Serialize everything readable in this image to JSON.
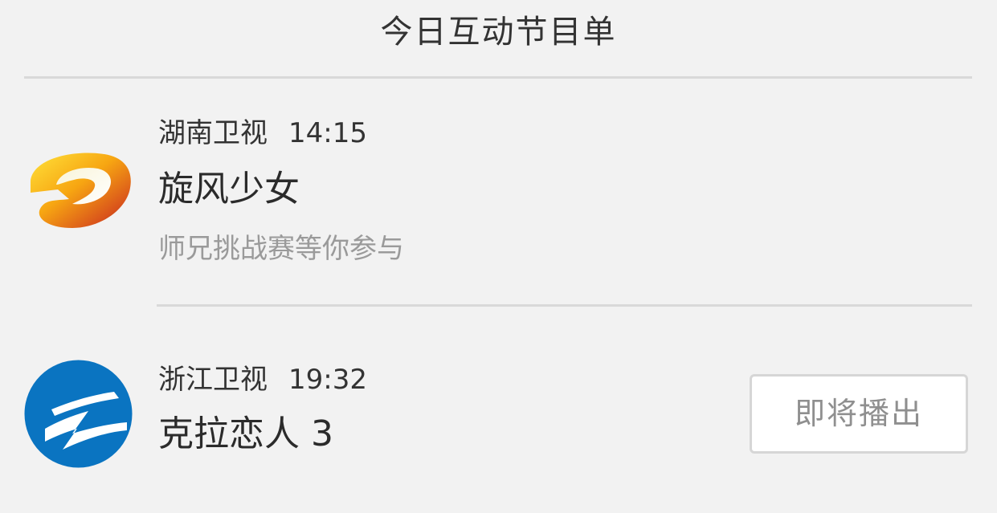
{
  "header": {
    "title": "今日互动节目单"
  },
  "programs": [
    {
      "channel": "湖南卫视",
      "time": "14:15",
      "title": "旋风少女",
      "description": "师兄挑战赛等你参与",
      "logo_icon": "hunan-tv-logo-icon",
      "colors": {
        "logo_primary": "#f5b800",
        "logo_secondary": "#c0390f"
      }
    },
    {
      "channel": "浙江卫视",
      "time": "19:32",
      "title": "克拉恋人 3",
      "status_label": "即将播出",
      "logo_icon": "zhejiang-tv-logo-icon",
      "colors": {
        "logo_primary": "#0a74c1"
      }
    }
  ]
}
